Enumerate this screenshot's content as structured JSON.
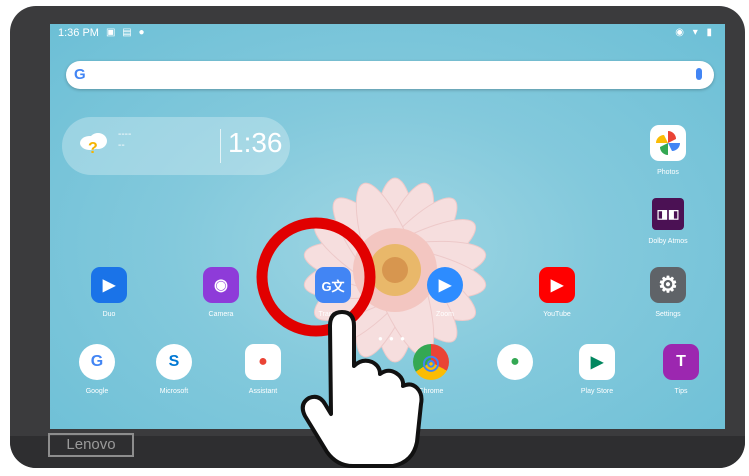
{
  "status_bar": {
    "time": "1:36 PM"
  },
  "search": {
    "engine_letter": "G"
  },
  "weather_widget": {
    "temp_line1": "----",
    "temp_line2": "--",
    "clock": "1:36"
  },
  "brand": {
    "logo": "Lenovo"
  },
  "right_column": [
    {
      "name": "photos",
      "label": "Photos",
      "icon": "pinwheel",
      "color": "#ffffff"
    },
    {
      "name": "dolby-atmos",
      "label": "Dolby Atmos",
      "icon": "dolby",
      "color": "#4b1154"
    }
  ],
  "apps_row1": [
    {
      "name": "duo",
      "label": "Duo",
      "color": "#1a73e8",
      "glyph": "▶"
    },
    {
      "name": "camera",
      "label": "Camera",
      "color": "#8e3bd9",
      "glyph": "◉"
    },
    {
      "name": "translate",
      "label": "Translate",
      "color": "#4285F4",
      "glyph": "G文"
    },
    {
      "name": "zoom",
      "label": "Zoom",
      "color": "#2d8cff",
      "glyph": "▶"
    },
    {
      "name": "youtube",
      "label": "YouTube",
      "color": "#ff0000",
      "glyph": "▶"
    },
    {
      "name": "settings",
      "label": "Settings",
      "color": "#5f6368",
      "glyph": "⚙"
    }
  ],
  "apps_row2": [
    {
      "name": "google",
      "label": "Google",
      "color": "#ffffff",
      "glyph": "G"
    },
    {
      "name": "microsoft",
      "label": "Microsoft",
      "color": "#ffffff",
      "glyph": "S"
    },
    {
      "name": "assistant",
      "label": "Assistant",
      "color": "#ffffff",
      "glyph": "●"
    },
    {
      "name": "chrome",
      "label": "Chrome",
      "color": "#ffffff",
      "glyph": "◎"
    },
    {
      "name": "lenovo-apps",
      "label": "",
      "color": "#ffffff",
      "glyph": "●"
    },
    {
      "name": "play-store",
      "label": "Play Store",
      "color": "#ffffff",
      "glyph": "▶"
    },
    {
      "name": "tips",
      "label": "Tips",
      "color": "#9c27b0",
      "glyph": "T"
    }
  ],
  "annotation": {
    "highlight_color": "#e10000",
    "target": "translate"
  }
}
